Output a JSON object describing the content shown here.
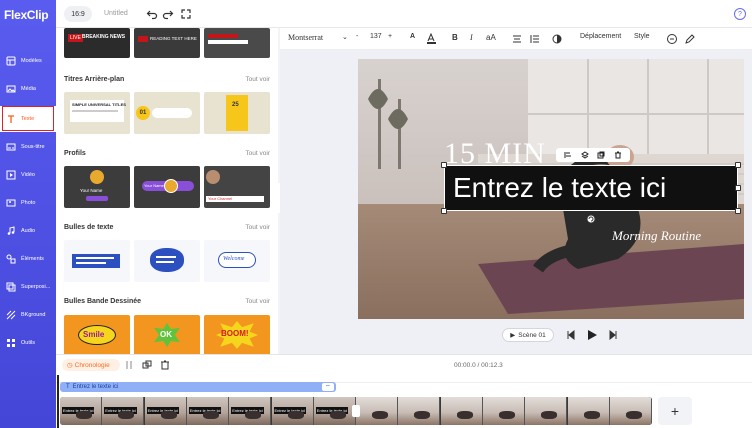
{
  "app": {
    "logo": "FlexClip"
  },
  "topbar": {
    "ratio": "16:9",
    "title": "Untitled",
    "help": "?"
  },
  "nav": {
    "items": [
      {
        "label": "Modèles",
        "icon": "template-icon"
      },
      {
        "label": "Média",
        "icon": "media-icon"
      },
      {
        "label": "Texte",
        "icon": "text-icon",
        "active": true
      },
      {
        "label": "Sous-titre",
        "icon": "subtitle-icon"
      },
      {
        "label": "Vidéo",
        "icon": "video-icon"
      },
      {
        "label": "Photo",
        "icon": "photo-icon"
      },
      {
        "label": "Audio",
        "icon": "audio-icon"
      },
      {
        "label": "Éléments",
        "icon": "elements-icon"
      },
      {
        "label": "Superposi...",
        "icon": "overlay-icon"
      },
      {
        "label": "BKground",
        "icon": "background-icon"
      },
      {
        "label": "Outils",
        "icon": "tools-icon"
      }
    ]
  },
  "panel": {
    "see_all": "Tout voir",
    "sections": [
      {
        "title": "Titres Arrière-plan"
      },
      {
        "title": "Profils"
      },
      {
        "title": "Bulles de texte"
      },
      {
        "title": "Bulles Bande Dessinée"
      }
    ],
    "top_thumbs": [
      "BREAKING NEWS",
      "READING TEXT HERE",
      ""
    ],
    "title_thumbs": [
      "SIMPLE UNIVERSAL TITLES",
      "01",
      "25"
    ],
    "profile_thumbs": [
      "Your Name",
      "Your Name",
      "Your Channel"
    ],
    "bubble_thumbs": [
      "",
      "",
      "Welcome"
    ],
    "comic_thumbs": [
      "Smile",
      "OK",
      "BOOM!"
    ]
  },
  "format_bar": {
    "font": "Montserrat",
    "font_size": "137",
    "minus": "-",
    "plus": "+",
    "bold": "B",
    "italic": "I",
    "case": "aA",
    "move": "Déplacement",
    "style": "Style"
  },
  "canvas": {
    "text_top": "15 MIN",
    "text_main": "Entrez le texte ici",
    "text_sub": "Morning Routine",
    "scene_button": "Scène 01"
  },
  "timeline": {
    "chrono": "Chronologie",
    "timecode": "00:00.0 / 00:12.3",
    "text_track": "Entrez le texte ici",
    "frame_label": "Entrez le texte ici",
    "add": "+"
  },
  "colors": {
    "nav": "#4f51e6",
    "accent": "#ff6a1a",
    "highlight": "#e0202a"
  }
}
